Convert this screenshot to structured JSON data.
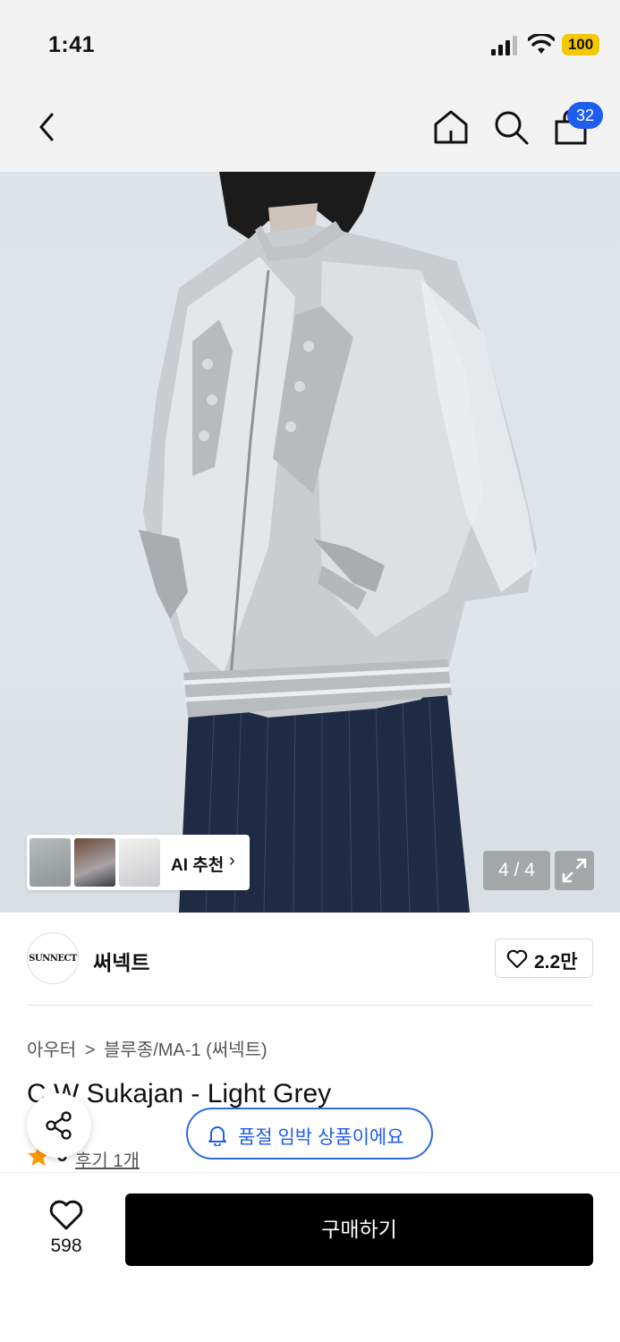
{
  "status_bar": {
    "time": "1:41",
    "battery": "100"
  },
  "nav": {
    "cart_count": "32"
  },
  "gallery": {
    "counter": "4 / 4",
    "ai_label": "AI 추천",
    "ai_chevron": "›"
  },
  "brand": {
    "logo_text": "SUNNECT",
    "name": "써넥트",
    "likes": "2.2만"
  },
  "product": {
    "breadcrumb": [
      "아우터",
      ">",
      "블루종/MA-1 (써넥트)"
    ],
    "title": "C  W Sukajan - Light Grey",
    "rating": "5",
    "reviews": "후기 1개"
  },
  "notice": {
    "soldout": "품절 임박 상품이에요"
  },
  "bottom": {
    "wish_count": "598",
    "buy_label": "구매하기"
  },
  "icons": [
    "back-icon",
    "home-icon",
    "search-icon",
    "shopping-bag-icon",
    "expand-icon",
    "heart-icon",
    "share-icon",
    "bell-icon",
    "star-icon"
  ],
  "colors": {
    "accent": "#1f5cf0",
    "buy_button": "#000000",
    "battery": "#f5c800",
    "star": "#ff9900"
  }
}
